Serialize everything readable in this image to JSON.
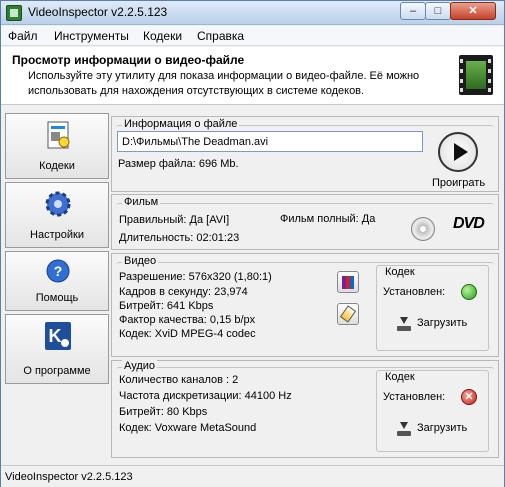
{
  "window": {
    "title": "VideoInspector v2.2.5.123",
    "minimize": "–",
    "maximize": "□",
    "close": "✕"
  },
  "menu": [
    "Файл",
    "Инструменты",
    "Кодеки",
    "Справка"
  ],
  "header": {
    "title": "Просмотр информации о видео-файле",
    "description": "Используйте эту утилиту для показа информации о видео-файле. Её можно использовать для нахождения отсутствующих в системе кодеков."
  },
  "sidebar": [
    {
      "label": "Кодеки",
      "icon": "codecs-icon"
    },
    {
      "label": "Настройки",
      "icon": "settings-gear-icon"
    },
    {
      "label": "Помощь",
      "icon": "help-icon"
    },
    {
      "label": "О программе",
      "icon": "about-icon"
    }
  ],
  "file_info": {
    "group_title": "Информация о файле",
    "path": "D:\\Фильмы\\The Deadman.avi",
    "size": "Размер файла: 696 Mb.",
    "play_label": "Проиграть"
  },
  "film": {
    "group_title": "Фильм",
    "valid": "Правильный: Да [AVI]",
    "complete": "Фильм полный: Да",
    "duration": "Длительность: 02:01:23",
    "dvd": "DVD"
  },
  "video": {
    "group_title": "Видео",
    "lines": [
      "Разрешение: 576x320 (1,80:1)",
      "Кадров в секунду: 23,974",
      "Битрейт: 641 Kbps",
      "Фактор качества: 0,15 b/px",
      "Кодек: XviD MPEG-4 codec"
    ],
    "codec": {
      "title": "Кодек",
      "installed": "Установлен:",
      "status": "ok",
      "download": "Загрузить"
    }
  },
  "audio": {
    "group_title": "Аудио",
    "lines": [
      "Количество каналов : 2",
      "Частота дискретизации: 44100 Hz",
      "Битрейт: 80 Kbps",
      "Кодек: Voxware MetaSound"
    ],
    "codec": {
      "title": "Кодек",
      "installed": "Установлен:",
      "status": "missing",
      "status_glyph": "✕",
      "download": "Загрузить"
    }
  },
  "statusbar": {
    "text": "VideoInspector v2.2.5.123"
  }
}
